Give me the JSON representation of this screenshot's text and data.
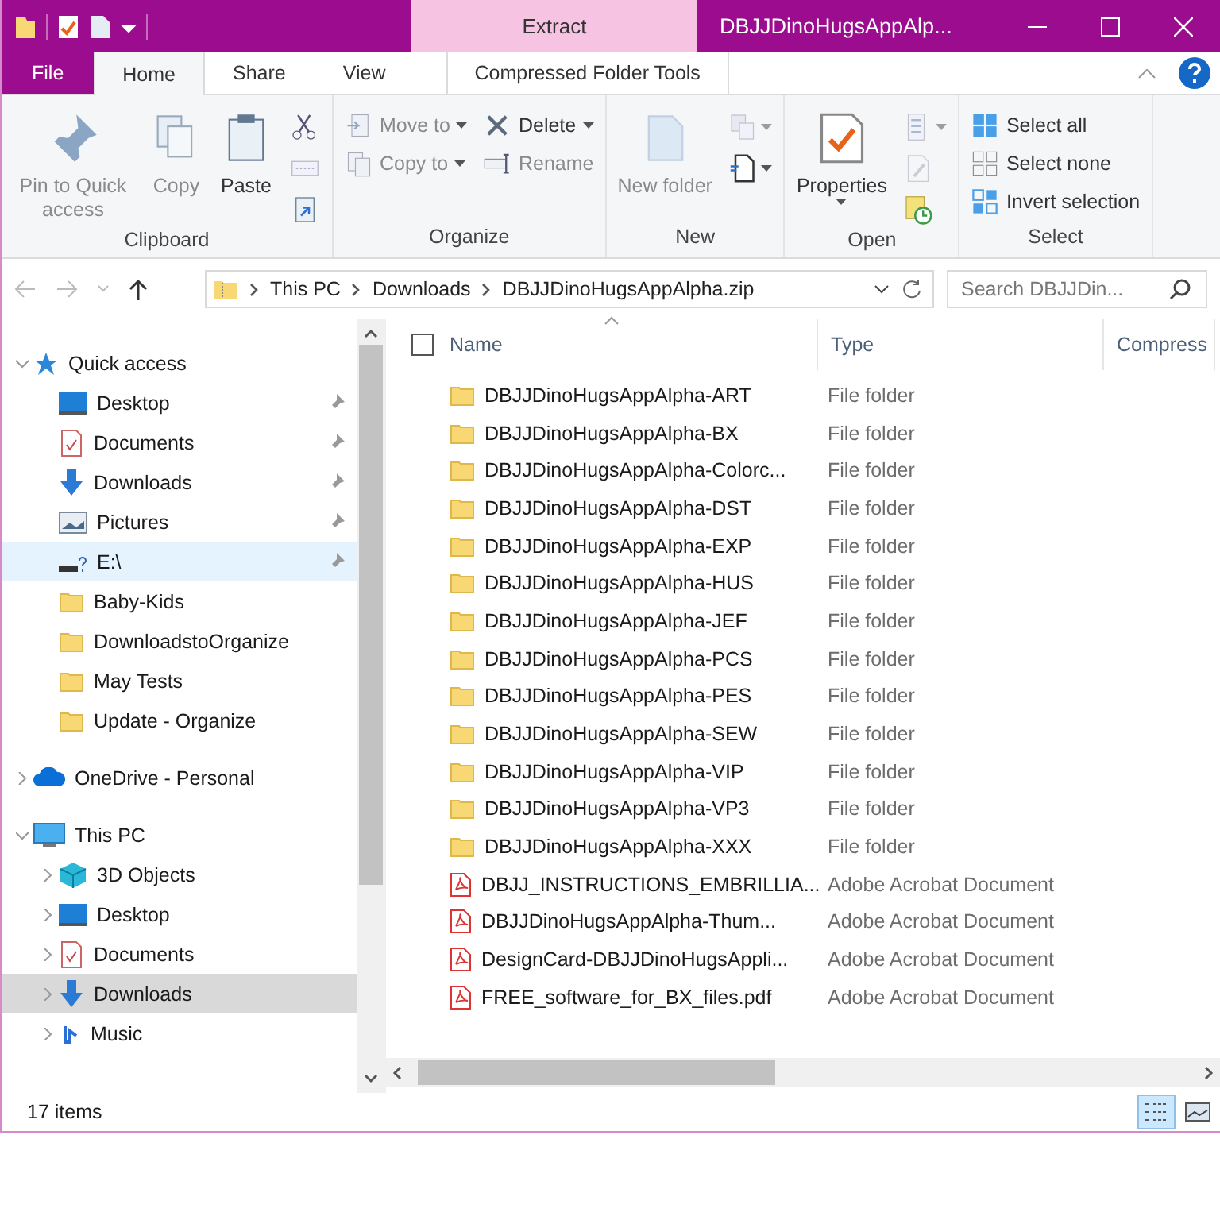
{
  "window": {
    "title": "DBJJDinoHugsAppAlp...",
    "context_tab": "Extract"
  },
  "ribbon_tabs": [
    {
      "label": "File",
      "kind": "file",
      "selected": false
    },
    {
      "label": "Home",
      "kind": "tab",
      "selected": true
    },
    {
      "label": "Share",
      "kind": "tab",
      "selected": false
    },
    {
      "label": "View",
      "kind": "tab",
      "selected": false
    },
    {
      "label": "Compressed Folder Tools",
      "kind": "context",
      "selected": false
    }
  ],
  "ribbon_groups": [
    {
      "label": "Clipboard",
      "columns": [
        [
          {
            "kind": "large",
            "label": "Pin to Quick access",
            "disabled": true,
            "dropdown": false
          }
        ],
        [
          {
            "kind": "large",
            "label": "Copy",
            "disabled": true,
            "dropdown": false
          }
        ],
        [
          {
            "kind": "large",
            "label": "Paste",
            "disabled": false,
            "dropdown": false
          }
        ],
        [
          {
            "kind": "icon",
            "disabled": false,
            "dropdown": false
          },
          {
            "kind": "icon",
            "disabled": true,
            "dropdown": false
          },
          {
            "kind": "icon",
            "disabled": false,
            "dropdown": false
          }
        ]
      ]
    },
    {
      "label": "Organize",
      "columns": [
        [
          {
            "kind": "small",
            "label": "Move to",
            "disabled": true,
            "dropdown": true
          },
          {
            "kind": "small",
            "label": "Copy to",
            "disabled": true,
            "dropdown": true
          }
        ],
        [
          {
            "kind": "small",
            "label": "Delete",
            "disabled": false,
            "dropdown": true
          },
          {
            "kind": "small",
            "label": "Rename",
            "disabled": true,
            "dropdown": false
          }
        ]
      ]
    },
    {
      "label": "New",
      "columns": [
        [
          {
            "kind": "large",
            "label": "New folder",
            "disabled": true,
            "dropdown": false
          }
        ],
        [
          {
            "kind": "icon",
            "disabled": true,
            "dropdown": true
          },
          {
            "kind": "icon",
            "disabled": false,
            "dropdown": true
          }
        ]
      ]
    },
    {
      "label": "Open",
      "columns": [
        [
          {
            "kind": "large",
            "label": "Properties",
            "disabled": false,
            "dropdown": true
          }
        ],
        [
          {
            "kind": "icon",
            "disabled": true,
            "dropdown": true
          },
          {
            "kind": "icon",
            "disabled": true,
            "dropdown": false
          },
          {
            "kind": "icon",
            "disabled": false,
            "dropdown": false
          }
        ]
      ]
    },
    {
      "label": "Select",
      "columns": [
        [
          {
            "kind": "small",
            "label": "Select all",
            "disabled": false,
            "dropdown": false
          },
          {
            "kind": "small",
            "label": "Select none",
            "disabled": false,
            "dropdown": false
          },
          {
            "kind": "small",
            "label": "Invert selection",
            "disabled": false,
            "dropdown": false
          }
        ]
      ]
    }
  ],
  "address": {
    "path": [
      "This PC",
      "Downloads",
      "DBJJDinoHugsAppAlpha.zip"
    ],
    "search_placeholder": "Search DBJJDin..."
  },
  "sidebar": [
    {
      "label": "Quick access",
      "kind": "star",
      "expanded": true,
      "selected": false,
      "hovered": false,
      "children": [
        {
          "label": "Desktop",
          "kind": "desktop",
          "pinned": true,
          "selected": false,
          "hovered": false
        },
        {
          "label": "Documents",
          "kind": "documents",
          "pinned": true,
          "selected": false,
          "hovered": false
        },
        {
          "label": "Downloads",
          "kind": "downloads",
          "pinned": true,
          "selected": false,
          "hovered": false
        },
        {
          "label": "Pictures",
          "kind": "pictures",
          "pinned": true,
          "selected": false,
          "hovered": false
        },
        {
          "label": "E:\\",
          "kind": "drive",
          "pinned": true,
          "selected": false,
          "hovered": true
        },
        {
          "label": "Baby-Kids",
          "kind": "folder",
          "pinned": false,
          "selected": false,
          "hovered": false
        },
        {
          "label": "DownloadstoOrganize",
          "kind": "folder",
          "pinned": false,
          "selected": false,
          "hovered": false
        },
        {
          "label": "May Tests",
          "kind": "folder",
          "pinned": false,
          "selected": false,
          "hovered": false
        },
        {
          "label": "Update - Organize",
          "kind": "folder",
          "pinned": false,
          "selected": false,
          "hovered": false
        }
      ]
    },
    {
      "label": "OneDrive - Personal",
      "kind": "cloud",
      "expanded": false,
      "selected": false,
      "hovered": false
    },
    {
      "label": "This PC",
      "kind": "pc",
      "expanded": true,
      "selected": false,
      "hovered": false,
      "children": [
        {
          "label": "3D Objects",
          "kind": "cube",
          "expanded": false,
          "selected": false,
          "hovered": false
        },
        {
          "label": "Desktop",
          "kind": "desktop",
          "expanded": false,
          "selected": false,
          "hovered": false
        },
        {
          "label": "Documents",
          "kind": "documents",
          "expanded": false,
          "selected": false,
          "hovered": false
        },
        {
          "label": "Downloads",
          "kind": "downloads",
          "expanded": false,
          "selected": true,
          "hovered": false
        },
        {
          "label": "Music",
          "kind": "music",
          "expanded": false,
          "selected": false,
          "hovered": false
        }
      ]
    }
  ],
  "table": {
    "select_all": {
      "checked": false
    },
    "columns": [
      "Name",
      "Type",
      "Compress"
    ],
    "rows": [
      {
        "name": "DBJJDinoHugsAppAlpha-ART",
        "type": "File folder",
        "kind": "folder"
      },
      {
        "name": "DBJJDinoHugsAppAlpha-BX",
        "type": "File folder",
        "kind": "folder"
      },
      {
        "name": "DBJJDinoHugsAppAlpha-Colorc...",
        "type": "File folder",
        "kind": "folder"
      },
      {
        "name": "DBJJDinoHugsAppAlpha-DST",
        "type": "File folder",
        "kind": "folder"
      },
      {
        "name": "DBJJDinoHugsAppAlpha-EXP",
        "type": "File folder",
        "kind": "folder"
      },
      {
        "name": "DBJJDinoHugsAppAlpha-HUS",
        "type": "File folder",
        "kind": "folder"
      },
      {
        "name": "DBJJDinoHugsAppAlpha-JEF",
        "type": "File folder",
        "kind": "folder"
      },
      {
        "name": "DBJJDinoHugsAppAlpha-PCS",
        "type": "File folder",
        "kind": "folder"
      },
      {
        "name": "DBJJDinoHugsAppAlpha-PES",
        "type": "File folder",
        "kind": "folder"
      },
      {
        "name": "DBJJDinoHugsAppAlpha-SEW",
        "type": "File folder",
        "kind": "folder"
      },
      {
        "name": "DBJJDinoHugsAppAlpha-VIP",
        "type": "File folder",
        "kind": "folder"
      },
      {
        "name": "DBJJDinoHugsAppAlpha-VP3",
        "type": "File folder",
        "kind": "folder"
      },
      {
        "name": "DBJJDinoHugsAppAlpha-XXX",
        "type": "File folder",
        "kind": "folder"
      },
      {
        "name": "DBJJ_INSTRUCTIONS_EMBRILLIA...",
        "type": "Adobe Acrobat Document",
        "kind": "pdf"
      },
      {
        "name": "DBJJDinoHugsAppAlpha-Thum...",
        "type": "Adobe Acrobat Document",
        "kind": "pdf"
      },
      {
        "name": "DesignCard-DBJJDinoHugsAppli...",
        "type": "Adobe Acrobat Document",
        "kind": "pdf"
      },
      {
        "name": "FREE_software_for_BX_files.pdf",
        "type": "Adobe Acrobat Document",
        "kind": "pdf"
      }
    ]
  },
  "status_bar": {
    "text": "17 items",
    "views": [
      {
        "kind": "details",
        "selected": true
      },
      {
        "kind": "large",
        "selected": false
      }
    ]
  }
}
